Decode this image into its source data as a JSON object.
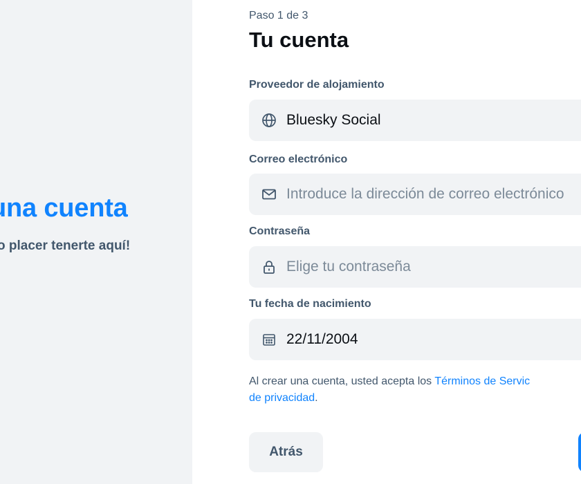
{
  "left": {
    "title": "una cuenta",
    "subtitle": "o placer tenerte aquí!"
  },
  "form": {
    "step": "Paso 1 de 3",
    "heading": "Tu cuenta",
    "hosting": {
      "label": "Proveedor de alojamiento",
      "value": "Bluesky Social",
      "icon": "globe-icon"
    },
    "email": {
      "label": "Correo electrónico",
      "placeholder": "Introduce la dirección de correo electrónico",
      "value": "",
      "icon": "envelope-icon"
    },
    "password": {
      "label": "Contraseña",
      "placeholder": "Elige tu contraseña",
      "value": "",
      "icon": "lock-icon"
    },
    "birthdate": {
      "label": "Tu fecha de nacimiento",
      "value": "22/11/2004",
      "icon": "calendar-icon"
    },
    "terms": {
      "prefix": "Al crear una cuenta, usted acepta los ",
      "tos_link": "Términos de Servic",
      "privacy_link": "de privacidad",
      "suffix": "."
    },
    "back_button": "Atrás"
  },
  "colors": {
    "accent": "#1083fe",
    "field_bg": "#f1f3f5",
    "muted_text": "#42576c",
    "placeholder": "#7c8a98"
  }
}
